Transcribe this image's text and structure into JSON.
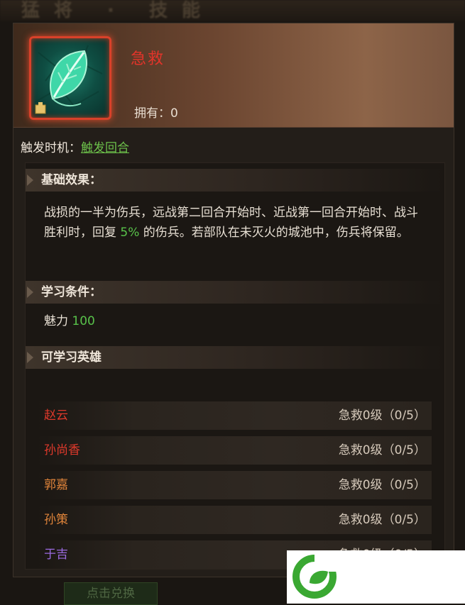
{
  "header_title_blur": "猛将 · 技能",
  "skill": {
    "name": "急救",
    "owned_label": "拥有：",
    "owned_value": "0",
    "icon": "green-leaf-icon"
  },
  "trigger": {
    "label": "触发时机：",
    "value": "触发回合"
  },
  "sections": {
    "basic": "基础效果：",
    "learn": "学习条件：",
    "heroes": "可学习英雄"
  },
  "effect": {
    "part1": "战损的一半为伤兵，远战第二回合开始时、近战第一回合开始时、战斗胜利时，回复 ",
    "pct": "5%",
    "part2": " 的伤兵。若部队在未灭火的城池中，伤兵将保留。"
  },
  "condition": {
    "label": "魅力 ",
    "value": "100"
  },
  "heroes": [
    {
      "name": "赵云",
      "level": "急救0级（0/5）",
      "color": "#e0392b"
    },
    {
      "name": "孙尚香",
      "level": "急救0级（0/5）",
      "color": "#e0392b"
    },
    {
      "name": "郭嘉",
      "level": "急救0级（0/5）",
      "color": "#e0843a"
    },
    {
      "name": "孙策",
      "level": "急救0级（0/5）",
      "color": "#e0843a"
    },
    {
      "name": "于吉",
      "level": "急救0级（0/5）",
      "color": "#9b6ae0"
    }
  ],
  "bottom_button": "点击兑换",
  "colors": {
    "accent_red": "#e2342a",
    "highlight_green": "#58c24a",
    "logo_green": "#3aa832"
  }
}
